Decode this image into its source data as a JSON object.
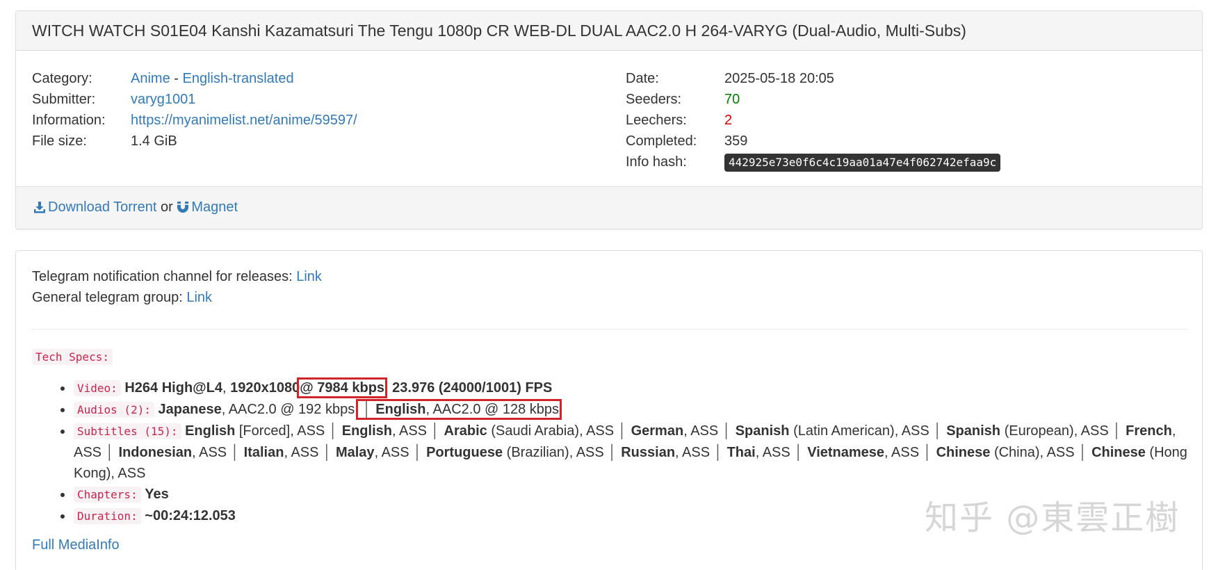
{
  "torrent": {
    "title": "WITCH WATCH S01E04 Kanshi Kazamatsuri The Tengu 1080p CR WEB-DL DUAL AAC2.0 H 264-VARYG (Dual-Audio, Multi-Subs)",
    "labels": {
      "category": "Category:",
      "submitter": "Submitter:",
      "information": "Information:",
      "file_size": "File size:",
      "date": "Date:",
      "seeders": "Seeders:",
      "leechers": "Leechers:",
      "completed": "Completed:",
      "info_hash": "Info hash:"
    },
    "category_main": "Anime",
    "category_sep": " - ",
    "category_sub": "English-translated",
    "submitter": "varyg1001",
    "information": "https://myanimelist.net/anime/59597/",
    "file_size": "1.4 GiB",
    "date": "2025-05-18 20:05",
    "seeders": "70",
    "leechers": "2",
    "completed": "359",
    "info_hash": "442925e73e0f6c4c19aa01a47e4f062742efaa9c",
    "download_label": "Download Torrent",
    "or_text": "or",
    "magnet_label": "Magnet"
  },
  "description": {
    "telegram_channel_text": "Telegram notification channel for releases:",
    "telegram_channel_link": "Link",
    "telegram_group_text": "General telegram group:",
    "telegram_group_link": "Link",
    "tech_specs_label": "Tech Specs:",
    "video": {
      "label": "Video:",
      "codec": "H264 High@L4",
      "resolution": "1920x1080",
      "bitrate": "@ 7984 kbps",
      "fps": "23.976 (24000/1001) FPS"
    },
    "audios": {
      "label": "Audios (2):",
      "a1_lang": "Japanese",
      "a1_rest": ", AAC2.0 @ 192 kbps",
      "a2_lang": "English",
      "a2_rest": ", AAC2.0 @ 128 kbps"
    },
    "subtitles_label": "Subtitles (15):",
    "subtitles": [
      {
        "lang": "English",
        "note": " [Forced]",
        "fmt": ", ASS"
      },
      {
        "lang": "English",
        "note": "",
        "fmt": ", ASS"
      },
      {
        "lang": "Arabic",
        "note": " (Saudi Arabia)",
        "fmt": ", ASS"
      },
      {
        "lang": "German",
        "note": "",
        "fmt": ", ASS"
      },
      {
        "lang": "Spanish",
        "note": " (Latin American)",
        "fmt": ", ASS"
      },
      {
        "lang": "Spanish",
        "note": " (European)",
        "fmt": ", ASS"
      },
      {
        "lang": "French",
        "note": "",
        "fmt": ", ASS"
      },
      {
        "lang": "Indonesian",
        "note": "",
        "fmt": ", ASS"
      },
      {
        "lang": "Italian",
        "note": "",
        "fmt": ", ASS"
      },
      {
        "lang": "Malay",
        "note": "",
        "fmt": ", ASS"
      },
      {
        "lang": "Portuguese",
        "note": " (Brazilian)",
        "fmt": ", ASS"
      },
      {
        "lang": "Russian",
        "note": "",
        "fmt": ", ASS"
      },
      {
        "lang": "Thai",
        "note": "",
        "fmt": ", ASS"
      },
      {
        "lang": "Vietnamese",
        "note": "",
        "fmt": ", ASS"
      },
      {
        "lang": "Chinese",
        "note": " (China)",
        "fmt": ", ASS"
      },
      {
        "lang": "Chinese",
        "note": " (Hong Kong)",
        "fmt": ", ASS"
      }
    ],
    "chapters_label": "Chapters:",
    "chapters_value": "Yes",
    "duration_label": "Duration:",
    "duration_value": "~00:24:12.053",
    "full_mediainfo": "Full MediaInfo"
  },
  "watermark": "知乎 @東雲正樹",
  "colors": {
    "link": "#337ab7",
    "seeders": "#008000",
    "leechers": "#d00000",
    "highlight_box": "#d0232a",
    "code_text": "#c7254e"
  },
  "icons": {
    "download": "download-icon",
    "magnet": "magnet-icon"
  }
}
